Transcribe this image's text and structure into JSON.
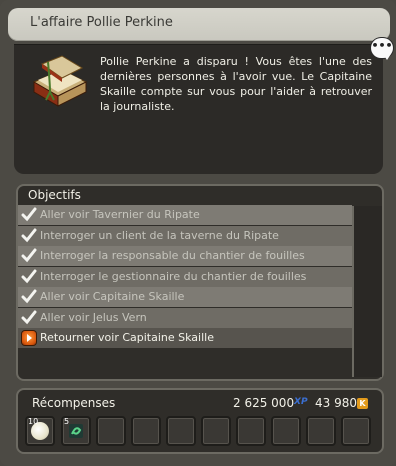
{
  "window": {
    "title": "L'affaire Pollie Perkine",
    "chat_icon": "speech-bubble-icon"
  },
  "description": {
    "icon": "quest-book-icon",
    "text": "Pollie Perkine a disparu ! Vous êtes l'une des dernières personnes à l'avoir vue. Le Capitaine Skaille compte sur vous pour l'aider à retrouver la journaliste."
  },
  "objectives": {
    "header": "Objectifs",
    "items": [
      {
        "label": "Aller voir Tavernier du Ripate",
        "status": "done",
        "icon": "checkmark-icon"
      },
      {
        "label": "Interroger un client de la taverne du Ripate",
        "status": "done",
        "icon": "checkmark-icon"
      },
      {
        "label": "Interroger la responsable du chantier de fouilles",
        "status": "done",
        "icon": "checkmark-icon"
      },
      {
        "label": "Interroger le gestionnaire du chantier de fouilles",
        "status": "done",
        "icon": "checkmark-icon"
      },
      {
        "label": "Aller voir Capitaine Skaille",
        "status": "done",
        "icon": "checkmark-icon"
      },
      {
        "label": "Aller voir Jelus Vern",
        "status": "done",
        "icon": "checkmark-icon"
      },
      {
        "label": "Retourner voir Capitaine Skaille",
        "status": "current",
        "icon": "play-arrow-icon"
      }
    ]
  },
  "rewards": {
    "header": "Récompenses",
    "xp": "2 625 000",
    "xp_label": "XP",
    "kamas": "43 980",
    "kamas_label": "K",
    "items": [
      {
        "qty": "10",
        "icon": "white-orb-icon"
      },
      {
        "qty": "5",
        "icon": "green-emblem-icon"
      }
    ]
  },
  "colors": {
    "title_bar": "#d7d6cd",
    "panel": "#2f2d29",
    "current_objective_icon": "#e86a14"
  }
}
